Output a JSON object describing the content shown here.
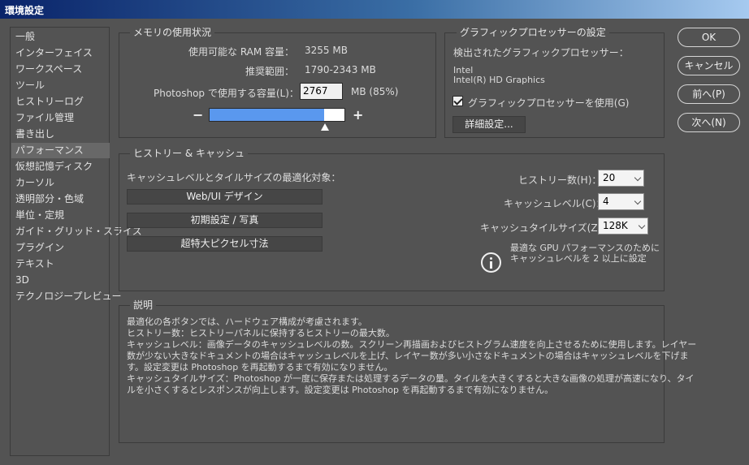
{
  "window": {
    "title": "環境設定"
  },
  "sidebar": {
    "items": [
      {
        "label": "一般"
      },
      {
        "label": "インターフェイス"
      },
      {
        "label": "ワークスペース"
      },
      {
        "label": "ツール"
      },
      {
        "label": "ヒストリーログ"
      },
      {
        "label": "ファイル管理"
      },
      {
        "label": "書き出し"
      },
      {
        "label": "パフォーマンス",
        "selected": true
      },
      {
        "label": "仮想記憶ディスク"
      },
      {
        "label": "カーソル"
      },
      {
        "label": "透明部分・色域"
      },
      {
        "label": "単位・定規"
      },
      {
        "label": "ガイド・グリッド・スライス"
      },
      {
        "label": "プラグイン"
      },
      {
        "label": "テキスト"
      },
      {
        "label": "3D"
      },
      {
        "label": "テクノロジープレビュー"
      }
    ]
  },
  "memory": {
    "title": "メモリの使用状況",
    "available_label": "使用可能な RAM 容量：",
    "available_value": "3255 MB",
    "range_label": "推奨範囲：",
    "range_value": "1790-2343 MB",
    "use_label": "Photoshop で使用する容量(L)：",
    "use_value": "2767",
    "use_unit": "MB (85%)",
    "slider_fraction": 0.85,
    "minus": "−",
    "plus": "+"
  },
  "gpu": {
    "title": "グラフィックプロセッサーの設定",
    "detected_label": "検出されたグラフィックプロセッサー：",
    "vendor": "Intel",
    "model": "Intel(R) HD Graphics",
    "use_gpu_label": "グラフィックプロセッサーを使用(G)",
    "use_gpu_checked": true,
    "advanced_button": "詳細設定..."
  },
  "history_cache": {
    "title": "ヒストリー & キャッシュ",
    "optimize_label": "キャッシュレベルとタイルサイズの最適化対象：",
    "preset_buttons": [
      "Web/UI デザイン",
      "初期設定 / 写真",
      "超特大ピクセル寸法"
    ],
    "history_states_label": "ヒストリー数(H)：",
    "history_states_value": "20",
    "cache_levels_label": "キャッシュレベル(C)：",
    "cache_levels_value": "4",
    "cache_tile_label": "キャッシュタイルサイズ(Z)：",
    "cache_tile_value": "128K",
    "gpu_note_line1": "最適な GPU パフォーマンスのために",
    "gpu_note_line2": "キャッシュレベルを 2 以上に設定"
  },
  "description": {
    "title": "説明",
    "lines": [
      "最適化の各ボタンでは、ハードウェア構成が考慮されます。",
      "ヒストリー数：ヒストリーパネルに保持するヒストリーの最大数。",
      "キャッシュレベル：画像データのキャッシュレベルの数。スクリーン再描画およびヒストグラム速度を向上させるために使用します。レイヤー",
      "数が少ない大きなドキュメントの場合はキャッシュレベルを上げ、レイヤー数が多い小さなドキュメントの場合はキャッシュレベルを下げま",
      "す。設定変更は Photoshop を再起動するまで有効になりません。",
      "キャッシュタイルサイズ：Photoshop が一度に保存または処理するデータの量。タイルを大きくすると大きな画像の処理が高速になり、タイ",
      "ルを小さくするとレスポンスが向上します。設定変更は Photoshop を再起動するまで有効になりません。"
    ]
  },
  "buttons": {
    "ok": "OK",
    "cancel": "キャンセル",
    "prev": "前へ(P)",
    "next": "次へ(N)"
  },
  "colors": {
    "background": "#535353",
    "slider_fill": "#5a98ee",
    "titlebar_start": "#0a246a",
    "titlebar_end": "#a6caf0"
  }
}
